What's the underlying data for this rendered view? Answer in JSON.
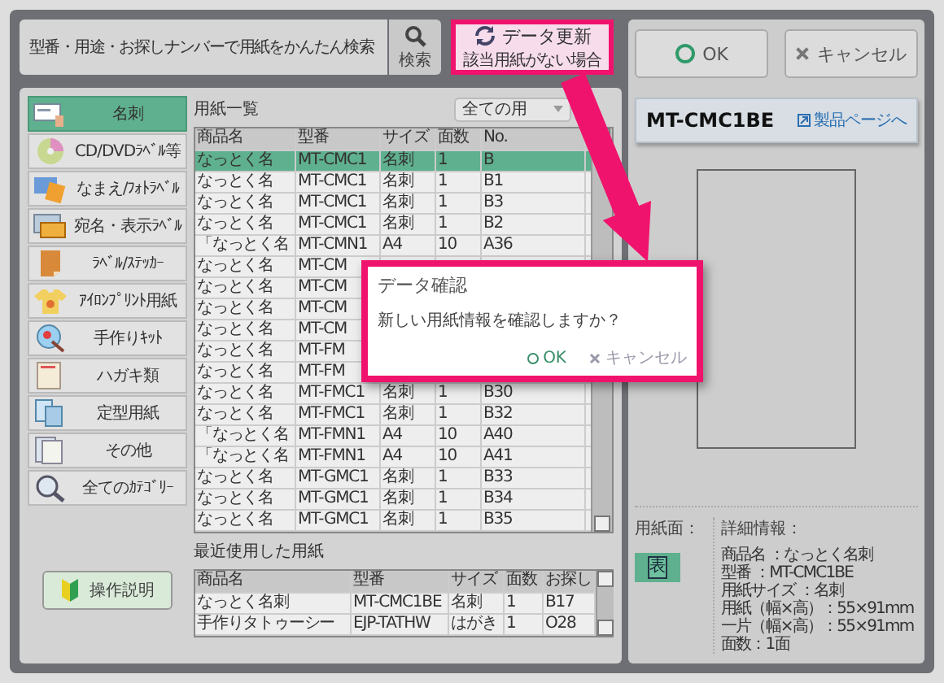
{
  "search": {
    "placeholder": "型番・用途・お探しナンバーで用紙をかんたん検索",
    "button": "検索"
  },
  "update_button": {
    "label": "データ更新",
    "sublabel": "該当用紙がない場合"
  },
  "sidebar": {
    "items": [
      {
        "label": "名刺",
        "selected": true
      },
      {
        "label": "CD/DVDﾗﾍﾞﾙ等",
        "selected": false
      },
      {
        "label": "なまえ/ﾌｫﾄﾗﾍﾞﾙ",
        "selected": false
      },
      {
        "label": "宛名・表示ﾗﾍﾞﾙ",
        "selected": false
      },
      {
        "label": "ﾗﾍﾞﾙ/ｽﾃｯｶｰ",
        "selected": false
      },
      {
        "label": "ｱｲﾛﾝﾌﾟﾘﾝﾄ用紙",
        "selected": false
      },
      {
        "label": "手作りｷｯﾄ",
        "selected": false
      },
      {
        "label": "ハガキ類",
        "selected": false
      },
      {
        "label": "定型用紙",
        "selected": false
      },
      {
        "label": "その他",
        "selected": false
      },
      {
        "label": "全てのｶﾃｺﾞﾘｰ",
        "selected": false
      }
    ],
    "help_button": "操作説明"
  },
  "paper_list": {
    "title": "用紙一覧",
    "filter": "全ての用",
    "columns": [
      "商品名",
      "型番",
      "サイズ",
      "面数",
      "No."
    ],
    "rows": [
      {
        "cells": [
          "なっとく名",
          "MT-CMC1",
          "名刺",
          "1",
          "B"
        ],
        "selected": true
      },
      {
        "cells": [
          "なっとく名",
          "MT-CMC1",
          "名刺",
          "1",
          "B1"
        ],
        "selected": false
      },
      {
        "cells": [
          "なっとく名",
          "MT-CMC1",
          "名刺",
          "1",
          "B3"
        ],
        "selected": false
      },
      {
        "cells": [
          "なっとく名",
          "MT-CMC1",
          "名刺",
          "1",
          "B2"
        ],
        "selected": false
      },
      {
        "cells": [
          "「なっとく名",
          "MT-CMN1",
          "A4",
          "10",
          "A36"
        ],
        "selected": false
      },
      {
        "cells": [
          "なっとく名",
          "MT-CM"
        ],
        "selected": false
      },
      {
        "cells": [
          "なっとく名",
          "MT-CM"
        ],
        "selected": false
      },
      {
        "cells": [
          "なっとく名",
          "MT-CM"
        ],
        "selected": false
      },
      {
        "cells": [
          "なっとく名",
          "MT-CM"
        ],
        "selected": false
      },
      {
        "cells": [
          "なっとく名",
          "MT-FM"
        ],
        "selected": false
      },
      {
        "cells": [
          "なっとく名",
          "MT-FM"
        ],
        "selected": false
      },
      {
        "cells": [
          "なっとく名",
          "MT-FMC1",
          "名刺",
          "1",
          "B30"
        ],
        "selected": false
      },
      {
        "cells": [
          "なっとく名",
          "MT-FMC1",
          "名刺",
          "1",
          "B32"
        ],
        "selected": false
      },
      {
        "cells": [
          "「なっとく名",
          "MT-FMN1",
          "A4",
          "10",
          "A40"
        ],
        "selected": false
      },
      {
        "cells": [
          "「なっとく名",
          "MT-FMN1",
          "A4",
          "10",
          "A41"
        ],
        "selected": false
      },
      {
        "cells": [
          "なっとく名",
          "MT-GMC1",
          "名刺",
          "1",
          "B33"
        ],
        "selected": false
      },
      {
        "cells": [
          "なっとく名",
          "MT-GMC1",
          "名刺",
          "1",
          "B34"
        ],
        "selected": false
      },
      {
        "cells": [
          "なっとく名",
          "MT-GMC1",
          "名刺",
          "1",
          "B35"
        ],
        "selected": false
      }
    ]
  },
  "recent": {
    "title": "最近使用した用紙",
    "columns": [
      "商品名",
      "型番",
      "サイズ",
      "面数",
      "お探し"
    ],
    "rows": [
      {
        "cells": [
          "なっとく名刺",
          "MT-CMC1BE",
          "名刺",
          "1",
          "B17"
        ]
      },
      {
        "cells": [
          "手作りタトゥーシー",
          "EJP-TATHW",
          "はがき",
          "1",
          "O28"
        ]
      }
    ]
  },
  "dialog": {
    "title": "データ確認",
    "message": "新しい用紙情報を確認しますか？",
    "ok": "OK",
    "cancel": "キャンセル"
  },
  "actions": {
    "ok": "OK",
    "cancel": "キャンセル"
  },
  "product": {
    "model": "MT-CMC1BE",
    "link": "製品ページへ",
    "side_label": "用紙面：",
    "side_icon": "表",
    "details_label": "詳細情報：",
    "details": [
      "商品名 ：なっとく名刺",
      "型番 ：MT-CMC1BE",
      "用紙サイズ ：名刺",
      "用紙（幅×高）：55×91mm",
      "一片（幅×高）：55×91mm",
      "面数：1面"
    ]
  }
}
